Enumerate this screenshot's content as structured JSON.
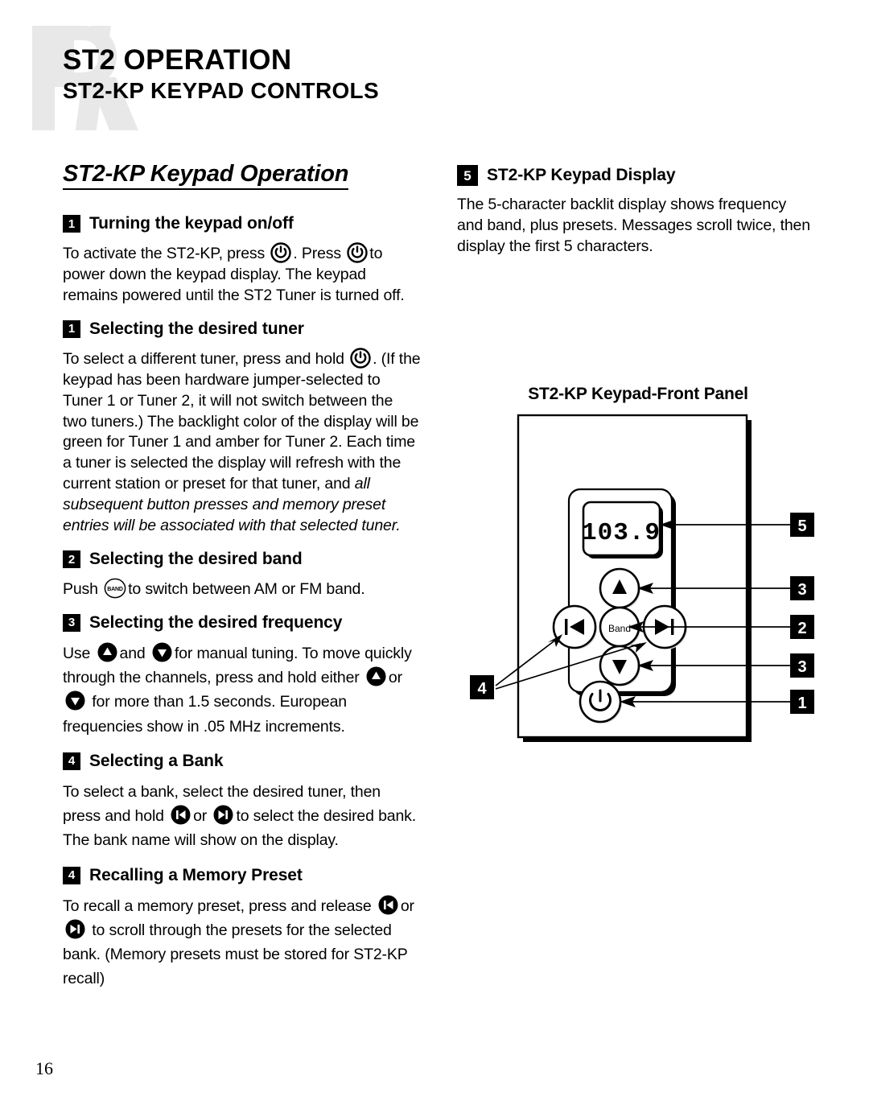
{
  "header": {
    "title": "ST2 OPERATION",
    "subtitle": "ST2-KP KEYPAD CONTROLS",
    "logo_letter": "R"
  },
  "left_column": {
    "section_title": "ST2-KP Keypad Operation",
    "sections": [
      {
        "badge": "1",
        "heading": "Turning the keypad on/off",
        "body_1": "To activate the ST2-KP, press",
        "body_2": ". Press",
        "body_3": "to power down the keypad display. The keypad remains powered until the ST2 Tuner is turned off."
      },
      {
        "badge": "1",
        "heading": "Selecting the desired tuner",
        "body_1": "To select a different tuner, press and hold",
        "body_2": ". (If the keypad has been hardware jumper-selected to Tuner 1 or Tuner 2, it will not switch between the two tuners.) The backlight color of the display will be green for Tuner 1 and amber for Tuner 2. Each time a tuner is selected the display will refresh with the current station or preset for that tuner, and",
        "body_italic": "all subsequent button presses and memory preset entries will be associated with that selected tuner."
      },
      {
        "badge": "2",
        "heading": "Selecting the desired band",
        "body_1": "Push",
        "body_2": "to switch between AM or FM band."
      },
      {
        "badge": "3",
        "heading": "Selecting the desired frequency",
        "body_1": "Use",
        "body_2": "and",
        "body_3": "for manual tuning. To move quickly through the channels, press and hold either",
        "body_4": "or",
        "body_5": "for more than 1.5 seconds. European frequencies show in .05 MHz increments."
      },
      {
        "badge": "4",
        "heading": "Selecting a Bank",
        "body_1": "To select a bank, select the desired tuner, then press and hold",
        "body_2": "or",
        "body_3": "to select the desired bank. The bank name will show on the display."
      },
      {
        "badge": "4",
        "heading": "Recalling a Memory Preset",
        "body_1": "To recall a memory preset, press and release",
        "body_2": "or",
        "body_3": "to scroll through the presets for the selected bank. (Memory presets must be stored for ST2-KP recall)"
      }
    ]
  },
  "right_column": {
    "display_section": {
      "badge": "5",
      "heading": "ST2-KP Keypad Display",
      "body": "The 5-character backlit display shows frequency and band, plus presets. Messages scroll twice, then display the first 5 characters."
    },
    "figure": {
      "title": "ST2-KP Keypad-Front Panel",
      "lcd_value": "103.9",
      "band_button_label": "Band",
      "callouts": [
        {
          "number": "5",
          "target": "lcd-display"
        },
        {
          "number": "3",
          "target": "up-button"
        },
        {
          "number": "2",
          "target": "band-button"
        },
        {
          "number": "3",
          "target": "down-button"
        },
        {
          "number": "1",
          "target": "power-button"
        },
        {
          "number": "4",
          "target": "skip-buttons"
        }
      ]
    }
  },
  "footer": {
    "page_number": "16"
  },
  "icons": {
    "power": "power-icon",
    "band": "band-icon",
    "up": "up-triangle-icon",
    "down": "down-triangle-icon",
    "skip_back": "skip-back-icon",
    "skip_forward": "skip-forward-icon"
  },
  "colors": {
    "ink": "#000000",
    "paper": "#ffffff",
    "watermark": "#e8e8e8"
  }
}
